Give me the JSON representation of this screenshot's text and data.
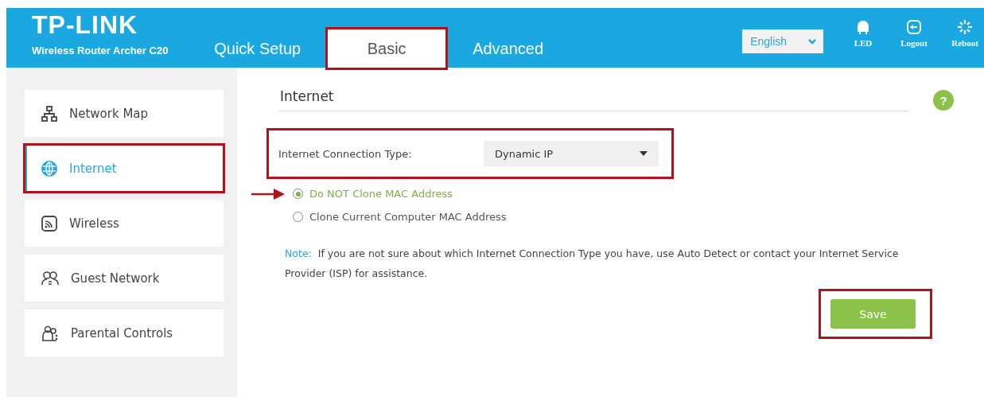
{
  "header": {
    "logo": "TP-LINK",
    "model": "Wireless Router Archer C20",
    "tabs": [
      {
        "label": "Quick Setup",
        "selected": false,
        "highlighted": false
      },
      {
        "label": "Basic",
        "selected": true,
        "highlighted": true
      },
      {
        "label": "Advanced",
        "selected": false,
        "highlighted": false
      }
    ],
    "language": "English",
    "actions": [
      {
        "kind": "led",
        "label": "LED"
      },
      {
        "kind": "logout",
        "label": "Logout"
      },
      {
        "kind": "reboot",
        "label": "Reboot"
      }
    ]
  },
  "sidebar": {
    "items": [
      {
        "kind": "map",
        "label": "Network Map",
        "selected": false,
        "highlighted": false
      },
      {
        "kind": "globe",
        "label": "Internet",
        "selected": true,
        "highlighted": true
      },
      {
        "kind": "wireless",
        "label": "Wireless",
        "selected": false,
        "highlighted": false
      },
      {
        "kind": "guest",
        "label": "Guest Network",
        "selected": false,
        "highlighted": false
      },
      {
        "kind": "parental",
        "label": "Parental Controls",
        "selected": false,
        "highlighted": false
      }
    ]
  },
  "main": {
    "title": "Internet",
    "help": "?",
    "connection": {
      "label": "Internet Connection Type:",
      "value": "Dynamic IP",
      "highlighted": true
    },
    "mac_options": [
      {
        "label": "Do NOT Clone MAC Address",
        "selected": true,
        "pointed": true
      },
      {
        "label": "Clone Current Computer MAC Address",
        "selected": false,
        "pointed": false
      }
    ],
    "note_label": "Note:",
    "note": "If you are not sure about which Internet Connection Type you have, use Auto Detect or contact your Internet Service Provider (ISP) for assistance.",
    "save": {
      "label": "Save",
      "highlighted": true
    }
  }
}
